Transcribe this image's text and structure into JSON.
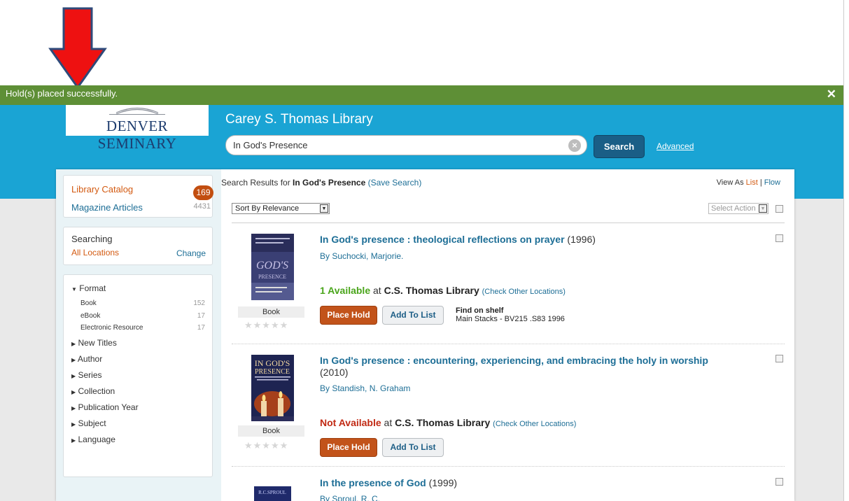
{
  "notice": {
    "message": "Hold(s) placed successfully.",
    "close": "✕"
  },
  "header": {
    "logo_text": "DENVER SEMINARY",
    "library_title": "Carey S. Thomas Library",
    "search_value": "In God's Presence",
    "search_button": "Search",
    "advanced_link": "Advanced",
    "brand_color": "#1aa4d4"
  },
  "sidebar": {
    "sources": [
      {
        "label": "Library Catalog",
        "count": "169"
      },
      {
        "label": "Magazine Articles",
        "count": "4431"
      }
    ],
    "searching_label": "Searching",
    "location_value": "All Locations",
    "change_link": "Change",
    "facets": {
      "format": {
        "label": "Format",
        "items": [
          {
            "label": "Book",
            "count": "152"
          },
          {
            "label": "eBook",
            "count": "17"
          },
          {
            "label": "Electronic Resource",
            "count": "17"
          }
        ]
      },
      "collapsed": [
        "New Titles",
        "Author",
        "Series",
        "Collection",
        "Publication Year",
        "Subject",
        "Language"
      ]
    }
  },
  "results": {
    "prefix": "Search Results for ",
    "query": "In God's Presence",
    "save_search": "(Save Search)",
    "view_as_label": "View As",
    "view_list": "List",
    "view_flow": "Flow",
    "sort_value": "Sort By Relevance",
    "select_action": "Select Action",
    "items": [
      {
        "title": "In God's presence : theological reflections on prayer",
        "year": "(1996)",
        "author": "By Suchocki, Marjorie.",
        "format": "Book",
        "availability": "1 Available",
        "at_text": " at ",
        "location": "C.S. Thomas Library",
        "check_other": "(Check Other Locations)",
        "place_hold": "Place Hold",
        "add_to_list": "Add To List",
        "shelf_label": "Find on shelf",
        "shelf_location": "Main Stacks - BV215 .S83 1996"
      },
      {
        "title": "In God's presence : encountering, experiencing, and embracing the holy in worship",
        "year": "(2010)",
        "author": "By Standish, N. Graham",
        "format": "Book",
        "availability": "Not Available",
        "at_text": " at ",
        "location": "C.S. Thomas Library",
        "check_other": "(Check Other Locations)",
        "place_hold": "Place Hold",
        "add_to_list": "Add To List"
      },
      {
        "title": "In the presence of God",
        "year": "(1999)",
        "author": "By Sproul, R. C."
      }
    ],
    "stars": "★★★★★"
  }
}
